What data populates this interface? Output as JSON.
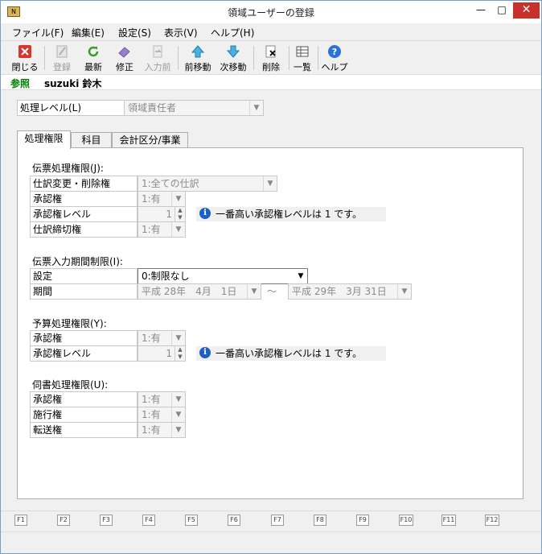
{
  "window": {
    "title": "領域ユーザーの登録",
    "icon_text": "N"
  },
  "menu": [
    "ファイル(F)",
    "編集(E)",
    "設定(S)",
    "表示(V)",
    "ヘルプ(H)"
  ],
  "toolbar": {
    "close": "閉じる",
    "register": "登録",
    "refresh": "最新",
    "modify": "修正",
    "before_input": "入力前",
    "prev": "前移動",
    "next": "次移動",
    "delete": "削除",
    "list": "一覧",
    "help": "ヘルプ"
  },
  "user": {
    "mode": "参照",
    "name": "suzuki 鈴木"
  },
  "level": {
    "label": "処理レベル(L)",
    "value": "領域責任者"
  },
  "tabs": [
    "処理権限",
    "科目",
    "会計区分/事業"
  ],
  "slip": {
    "title": "伝票処理権限(J):",
    "rows": [
      {
        "label": "仕訳変更・削除権",
        "value": "1:全ての仕訳"
      },
      {
        "label": "承認権",
        "value": "1:有"
      },
      {
        "label": "承認権レベル",
        "value": "1"
      },
      {
        "label": "仕訳締切権",
        "value": "1:有"
      }
    ],
    "info": "一番高い承認権レベルは 1 です。"
  },
  "period": {
    "title": "伝票入力期間制限(I):",
    "setting_label": "設定",
    "setting_value": "0:制限なし",
    "period_label": "期間",
    "from": "平成 28年　4月　1日",
    "tilde": "～",
    "to": "平成 29年　3月 31日"
  },
  "budget": {
    "title": "予算処理権限(Y):",
    "rows": [
      {
        "label": "承認権",
        "value": "1:有"
      },
      {
        "label": "承認権レベル",
        "value": "1"
      }
    ],
    "info": "一番高い承認権レベルは 1 です。"
  },
  "memo": {
    "title": "伺書処理権限(U):",
    "rows": [
      {
        "label": "承認権",
        "value": "1:有"
      },
      {
        "label": "施行権",
        "value": "1:有"
      },
      {
        "label": "転送権",
        "value": "1:有"
      }
    ]
  },
  "fkeys": [
    "F1",
    "F2",
    "F3",
    "F4",
    "F5",
    "F6",
    "F7",
    "F8",
    "F9",
    "F10",
    "F11",
    "F12"
  ],
  "colors": {
    "accent": "#1e60c0",
    "close_button": "#c7302b",
    "mode_text": "#008000"
  }
}
